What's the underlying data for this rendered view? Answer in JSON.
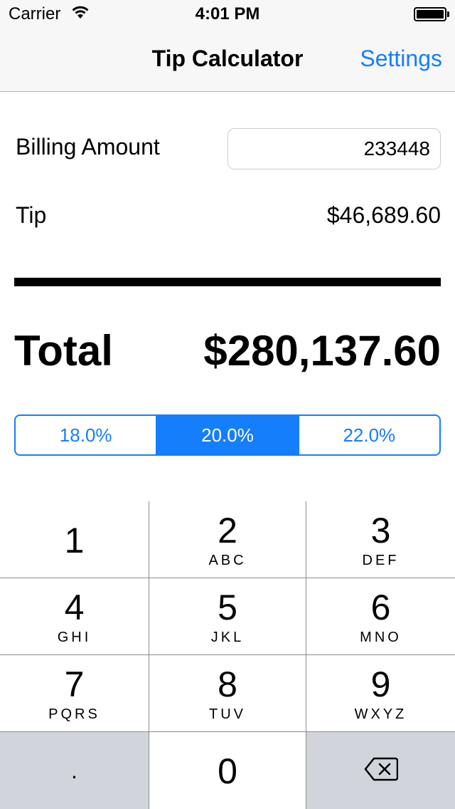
{
  "status_bar": {
    "carrier": "Carrier",
    "time": "4:01 PM"
  },
  "nav": {
    "title": "Tip Calculator",
    "settings_label": "Settings"
  },
  "billing": {
    "label": "Billing Amount",
    "value": "233448"
  },
  "tip": {
    "label": "Tip",
    "value": "$46,689.60"
  },
  "total": {
    "label": "Total",
    "value": "$280,137.60"
  },
  "tip_options": {
    "segments": [
      "18.0%",
      "20.0%",
      "22.0%"
    ],
    "selected": "20.0%"
  },
  "keypad": {
    "keys": [
      {
        "digit": "1",
        "letters": ""
      },
      {
        "digit": "2",
        "letters": "ABC"
      },
      {
        "digit": "3",
        "letters": "DEF"
      },
      {
        "digit": "4",
        "letters": "GHI"
      },
      {
        "digit": "5",
        "letters": "JKL"
      },
      {
        "digit": "6",
        "letters": "MNO"
      },
      {
        "digit": "7",
        "letters": "PQRS"
      },
      {
        "digit": "8",
        "letters": "TUV"
      },
      {
        "digit": "9",
        "letters": "WXYZ"
      },
      {
        "digit": ".",
        "letters": ""
      },
      {
        "digit": "0",
        "letters": ""
      }
    ]
  },
  "colors": {
    "accent": "#157efb",
    "keypad_dark": "#d1d5db"
  }
}
